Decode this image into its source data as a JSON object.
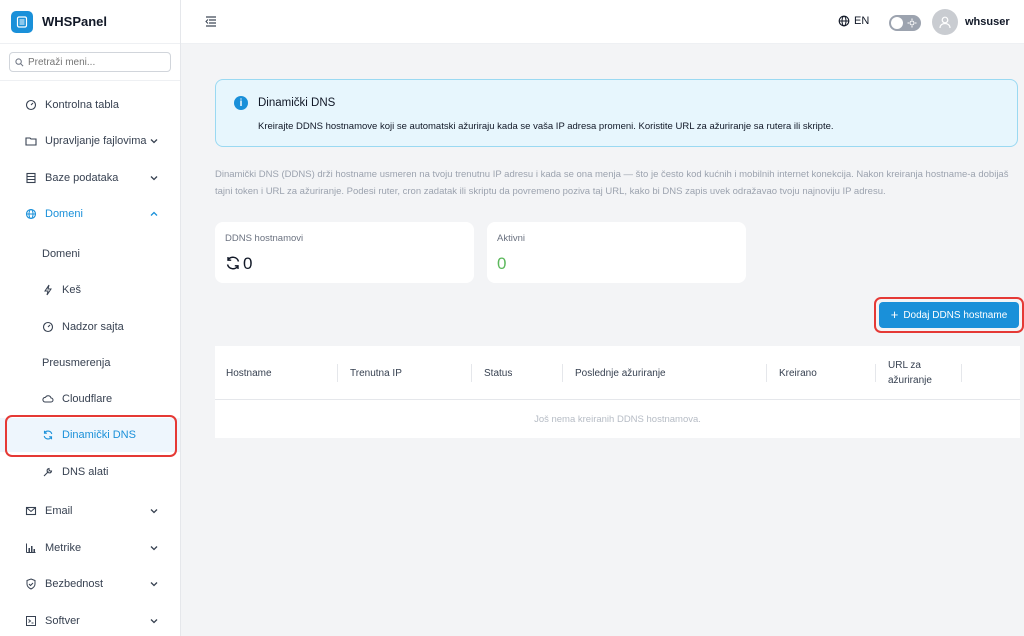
{
  "brand": {
    "title": "WHSPanel"
  },
  "sidebar": {
    "search_placeholder": "Pretraži meni...",
    "items": [
      {
        "label": "Kontrolna tabla"
      },
      {
        "label": "Upravljanje fajlovima"
      },
      {
        "label": "Baze podataka"
      },
      {
        "label": "Domeni"
      },
      {
        "label": "Email"
      },
      {
        "label": "Metrike"
      },
      {
        "label": "Bezbednost"
      },
      {
        "label": "Softver"
      }
    ],
    "domains_sub": [
      {
        "label": "Domeni"
      },
      {
        "label": "Keš"
      },
      {
        "label": "Nadzor sajta"
      },
      {
        "label": "Preusmerenja"
      },
      {
        "label": "Cloudflare"
      },
      {
        "label": "Dinamički DNS"
      },
      {
        "label": "DNS alati"
      }
    ]
  },
  "header": {
    "language": "EN",
    "username": "whsuser"
  },
  "info": {
    "title": "Dinamički DNS",
    "text": "Kreirajte DDNS hostnamove koji se automatski ažuriraju kada se vaša IP adresa promeni. Koristite URL za ažuriranje sa rutera ili skripte."
  },
  "description": "Dinamički DNS (DDNS) drži hostname usmeren na tvoju trenutnu IP adresu i kada se ona menja — što je često kod kućnih i mobilnih internet konekcija. Nakon kreiranja hostname-a dobijaš tajni token i URL za ažuriranje. Podesi ruter, cron zadatak ili skriptu da povremeno poziva taj URL, kako bi DNS zapis uvek odražavao tvoju najnoviju IP adresu.",
  "stats": {
    "hostnames": {
      "label": "DDNS hostnamovi",
      "value": "0"
    },
    "active": {
      "label": "Aktivni",
      "value": "0"
    }
  },
  "actions": {
    "add_label": "Dodaj DDNS hostname"
  },
  "table": {
    "columns": [
      "Hostname",
      "Trenutna IP",
      "Status",
      "Poslednje ažuriranje",
      "Kreirano",
      "URL za",
      "ažuriranje"
    ],
    "empty_text": "Još nema kreiranih DDNS hostnamova."
  },
  "colors": {
    "accent": "#1a90d9",
    "highlight": "#e53935",
    "active_value": "#5cb85c"
  }
}
